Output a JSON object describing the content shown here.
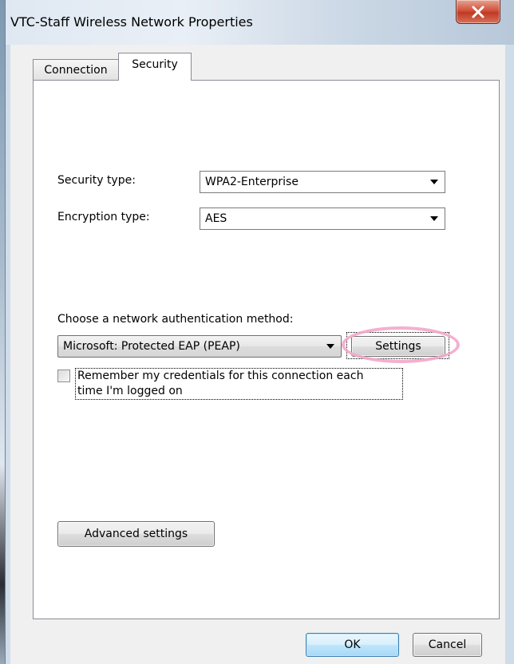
{
  "window": {
    "title": "VTC-Staff Wireless Network Properties",
    "close_icon": "close-icon"
  },
  "tabs": [
    {
      "label": "Connection",
      "selected": false
    },
    {
      "label": "Security",
      "selected": true
    }
  ],
  "security": {
    "security_type_label": "Security type:",
    "security_type_value": "WPA2-Enterprise",
    "encryption_type_label": "Encryption type:",
    "encryption_type_value": "AES",
    "auth_method_label": "Choose a network authentication method:",
    "auth_method_value": "Microsoft: Protected EAP (PEAP)",
    "settings_button": "Settings",
    "remember_line1": "Remember my credentials for this connection each",
    "remember_line2": "time I'm logged on",
    "remember_checked": false,
    "advanced_button": "Advanced settings"
  },
  "footer": {
    "ok_label": "OK",
    "cancel_label": "Cancel"
  },
  "colors": {
    "highlight_ring": "#f3a7c9",
    "close_button": "#c03a24"
  }
}
